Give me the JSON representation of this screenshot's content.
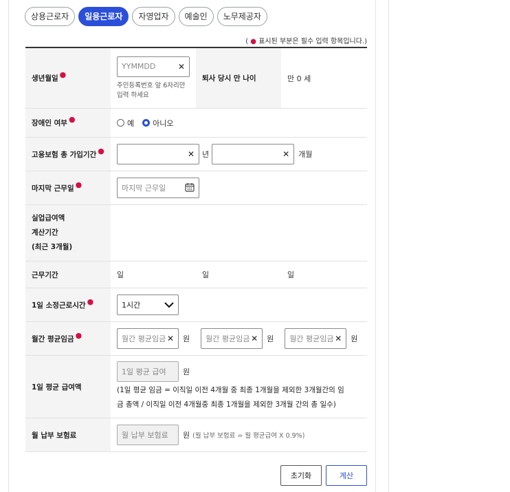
{
  "tabs": [
    "상용근로자",
    "일용근로자",
    "자영업자",
    "예술인",
    "노무제공자"
  ],
  "active_tab": 1,
  "notice": {
    "open": "(",
    "text": "표시된 부분은 필수 입력 항목입니다.)"
  },
  "birth": {
    "label": "생년월일",
    "placeholder": "YYMMDD",
    "help1": "주민등록번호 앞 6자리만",
    "help2": "입력 하세요"
  },
  "retire_age": {
    "label": "퇴사 당시 만 나이",
    "value": "만 0 세"
  },
  "disability": {
    "label": "장애인 여부",
    "yes": "예",
    "no": "아니오",
    "selected": "no"
  },
  "insurance_period": {
    "label": "고용보험 총 가입기간",
    "year_unit": "년",
    "month_unit": "개월"
  },
  "last_work_day": {
    "label": "마지막 근무일",
    "placeholder": "마지막 근무일"
  },
  "calc_period": {
    "label1": "실업급여액",
    "label2": "계산기간",
    "label3": "(최근 3개월)"
  },
  "work_period": {
    "label": "근무기간",
    "units": [
      "일",
      "일",
      "일"
    ]
  },
  "daily_hours": {
    "label": "1일 소정근로시간",
    "value": "1시간"
  },
  "monthly_wage": {
    "label": "월간 평균임금",
    "placeholder": "월간 평균임금",
    "unit": "원"
  },
  "daily_avg": {
    "label": "1일 평균 급여액",
    "placeholder": "1일 평균 급여",
    "unit": "원",
    "note1": "(1일 평균 임금 = 이직일 이전 4개월 중 최종 1개월을 제외한 3개월간의 임",
    "note2": "금 총액 / 이직일 이전 4개월중 최종 1개월을 제외한 3개월 간의 총 일수)"
  },
  "premium": {
    "label": "월 납부 보험료",
    "placeholder": "월 납부 보험료",
    "unit": "원",
    "note": "(월 납부 보험료 = 월 평균급여 X 0.9%)"
  },
  "buttons": {
    "reset": "초기화",
    "calc": "계산"
  },
  "colors": {
    "accent": "#2b4fd8",
    "required": "#d31145"
  }
}
